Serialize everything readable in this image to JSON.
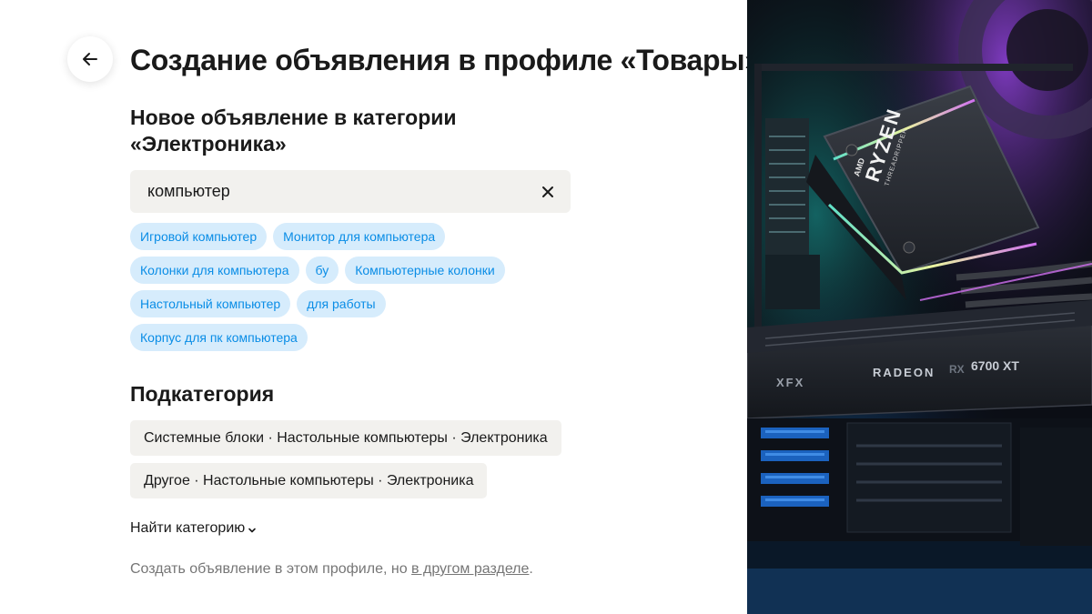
{
  "page": {
    "title": "Создание объявления в профиле «Товары»",
    "section_title": "Новое объявление в категории «Электроника»"
  },
  "search": {
    "value": "компьютер"
  },
  "suggestions": [
    "Игровой компьютер",
    "Монитор для компьютера",
    "Колонки для компьютера",
    "бу",
    "Компьютерные колонки",
    "Настольный компьютер",
    "для работы",
    "Корпус для пк компьютера"
  ],
  "subcategory": {
    "title": "Подкатегория",
    "items": [
      "Системные блоки · Настольные компьютеры · Электроника",
      "Другое · Настольные компьютеры · Электроника"
    ]
  },
  "find_category": {
    "label": "Найти категорию"
  },
  "footer": {
    "text": "Создать объявление в этом профиле, но ",
    "link": "в другом разделе",
    "suffix": "."
  },
  "hero": {
    "cooler_brand": "AMD",
    "cooler_model": "RYZEN",
    "cooler_sub": "THREADRIPPER",
    "gpu_brand": "XFX",
    "gpu_model": "RADEON",
    "gpu_rx": "RX",
    "gpu_number": "6700 XT"
  },
  "colors": {
    "chip_bg": "#d6ecfc",
    "chip_text": "#0a8de6",
    "field_bg": "#f2f1ee",
    "muted_text": "#767676"
  }
}
